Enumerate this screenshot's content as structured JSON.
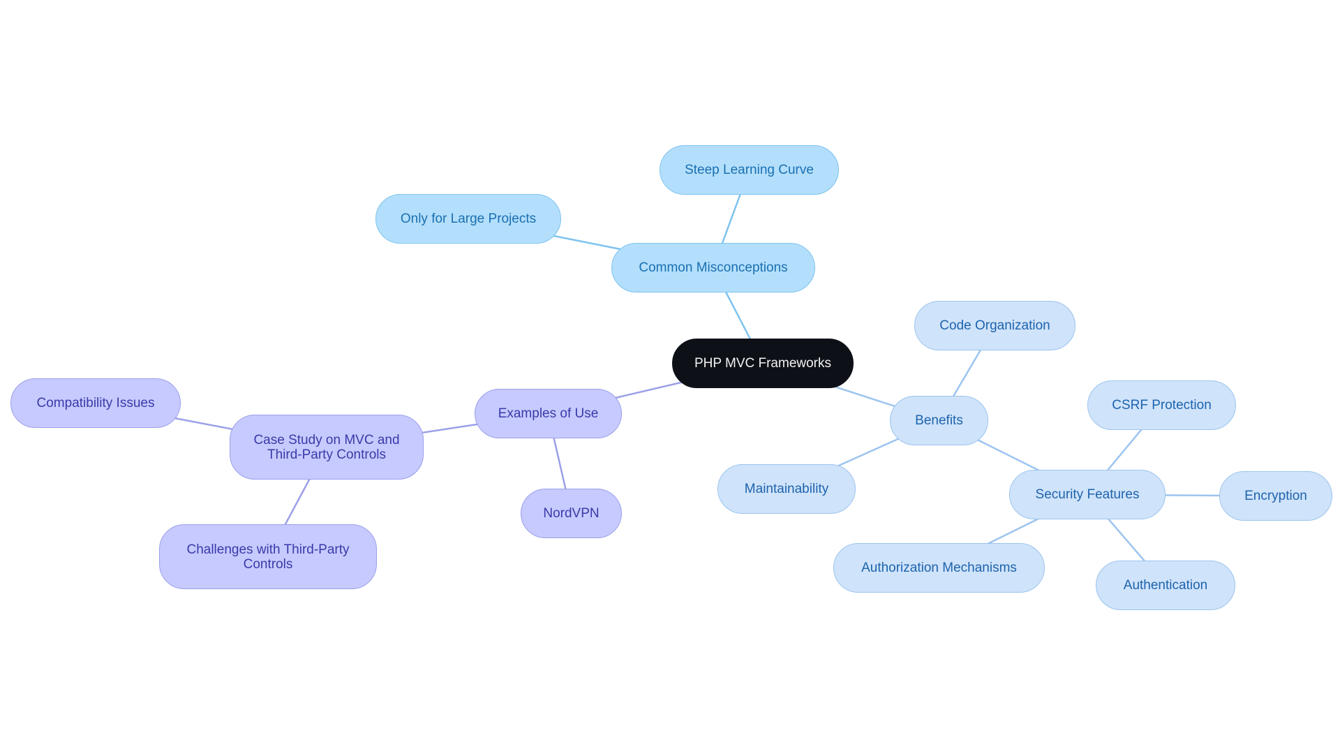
{
  "diagram": {
    "type": "mindmap",
    "root": {
      "id": "root",
      "label": "PHP MVC Frameworks"
    },
    "nodes": [
      {
        "id": "mis",
        "label": "Common Misconceptions",
        "parent": "root",
        "group": "mis"
      },
      {
        "id": "steep",
        "label": "Steep Learning Curve",
        "parent": "mis",
        "group": "mis"
      },
      {
        "id": "large",
        "label": "Only for Large Projects",
        "parent": "mis",
        "group": "mis"
      },
      {
        "id": "ben",
        "label": "Benefits",
        "parent": "root",
        "group": "ben"
      },
      {
        "id": "code",
        "label": "Code Organization",
        "parent": "ben",
        "group": "ben"
      },
      {
        "id": "maint",
        "label": "Maintainability",
        "parent": "ben",
        "group": "ben"
      },
      {
        "id": "sec",
        "label": "Security Features",
        "parent": "ben",
        "group": "ben"
      },
      {
        "id": "csrf",
        "label": "CSRF Protection",
        "parent": "sec",
        "group": "ben"
      },
      {
        "id": "enc",
        "label": "Encryption",
        "parent": "sec",
        "group": "ben"
      },
      {
        "id": "authn",
        "label": "Authentication",
        "parent": "sec",
        "group": "ben"
      },
      {
        "id": "authz",
        "label": "Authorization Mechanisms",
        "parent": "sec",
        "group": "ben"
      },
      {
        "id": "ex",
        "label": "Examples of Use",
        "parent": "root",
        "group": "ex"
      },
      {
        "id": "nord",
        "label": "NordVPN",
        "parent": "ex",
        "group": "ex"
      },
      {
        "id": "case",
        "label": "Case Study on MVC and Third-Party Controls",
        "parent": "ex",
        "group": "ex"
      },
      {
        "id": "compat",
        "label": "Compatibility Issues",
        "parent": "case",
        "group": "ex"
      },
      {
        "id": "chall",
        "label": "Challenges with Third-Party Controls",
        "parent": "case",
        "group": "ex"
      }
    ],
    "colors": {
      "root_fill": "#0d1117",
      "misconceptions_fill": "#b3dffc",
      "misconceptions_edge": "#7fc3ef",
      "benefits_fill": "#cfe3fa",
      "benefits_edge": "#9cc4ef",
      "examples_fill": "#c7caff",
      "examples_edge": "#9b9fe8"
    }
  }
}
